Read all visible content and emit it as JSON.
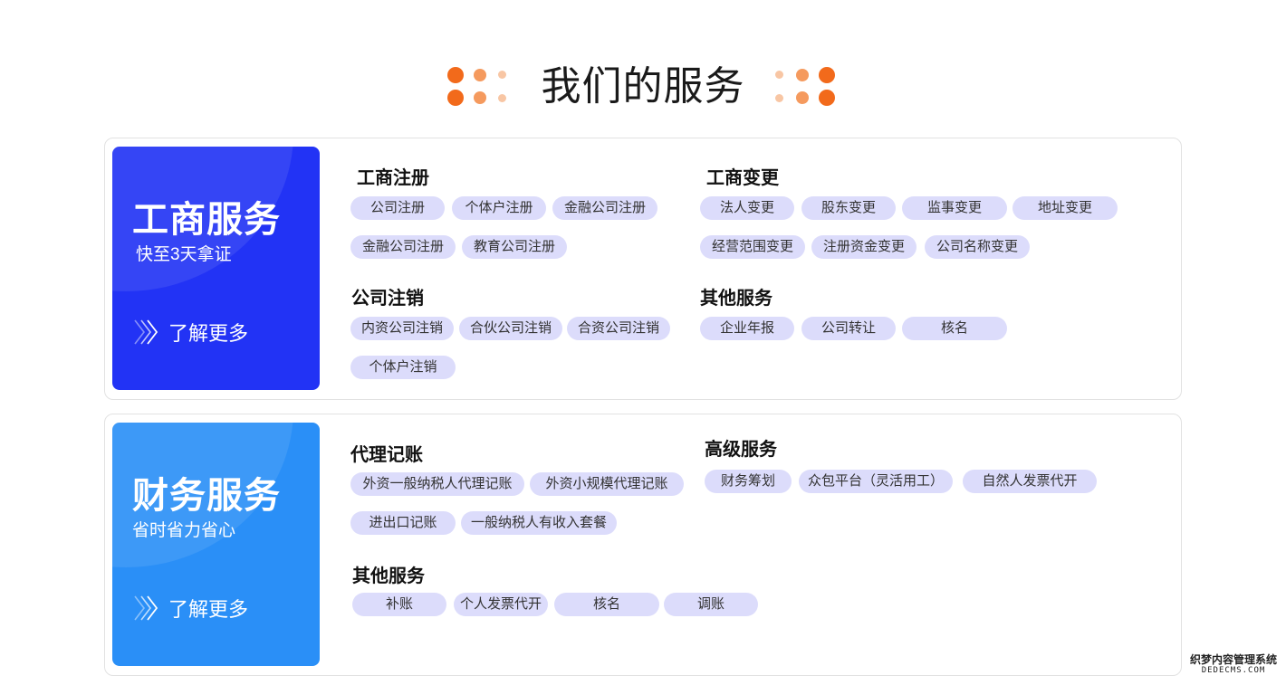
{
  "header": {
    "title": "我们的服务"
  },
  "colors": {
    "accent_orange": "#f26a1b",
    "orange_mid": "#f59a5e",
    "orange_light": "#f8c6a4",
    "blue_deep": "#2233f5",
    "blue_light": "#2a8ff7",
    "tag_bg": "#dcdcfb"
  },
  "cards": [
    {
      "promo": {
        "title": "工商服务",
        "subtitle": "快至3天拿证",
        "learn_more": "了解更多",
        "icon": "double-chevron-right-icon"
      },
      "sections": [
        {
          "title": "工商注册",
          "tags": [
            "公司注册",
            "个体户注册",
            "金融公司注册",
            "金融公司注册",
            "教育公司注册"
          ]
        },
        {
          "title": "工商变更",
          "tags": [
            "法人变更",
            "股东变更",
            "监事变更",
            "地址变更",
            "经营范围变更",
            "注册资金变更",
            "公司名称变更"
          ]
        },
        {
          "title": "公司注销",
          "tags": [
            "内资公司注销",
            "合伙公司注销",
            "合资公司注销",
            "个体户注销"
          ]
        },
        {
          "title": "其他服务",
          "tags": [
            "企业年报",
            "公司转让",
            "核名"
          ]
        }
      ]
    },
    {
      "promo": {
        "title": "财务服务",
        "subtitle": "省时省力省心",
        "learn_more": "了解更多",
        "icon": "double-chevron-right-icon"
      },
      "sections": [
        {
          "title": "代理记账",
          "tags": [
            "外资一般纳税人代理记账",
            "外资小规模代理记账",
            "进出口记账",
            "一般纳税人有收入套餐"
          ]
        },
        {
          "title": "高级服务",
          "tags": [
            "财务筹划",
            "众包平台（灵活用工）",
            "自然人发票代开"
          ]
        },
        {
          "title": "其他服务",
          "tags": [
            "补账",
            "个人发票代开",
            "核名",
            "调账"
          ]
        }
      ]
    }
  ],
  "watermark": {
    "line1": "织梦内容管理系统",
    "line2": "DEDECMS.COM"
  }
}
